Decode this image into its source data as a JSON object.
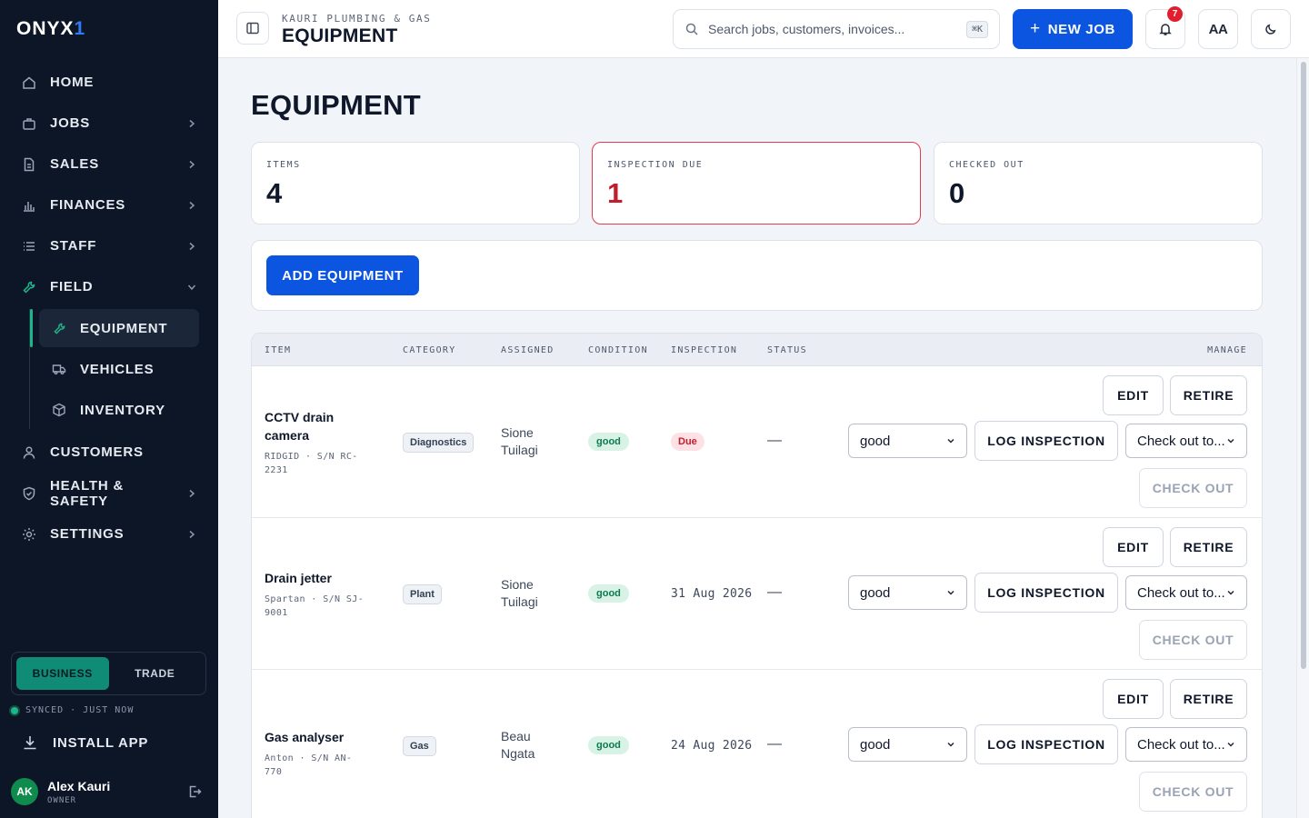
{
  "brand": {
    "logo_text": "ONYX",
    "logo_accent": "1"
  },
  "sidebar": {
    "items": [
      {
        "label": "HOME",
        "icon": "home-icon"
      },
      {
        "label": "JOBS",
        "icon": "briefcase-icon"
      },
      {
        "label": "SALES",
        "icon": "document-icon"
      },
      {
        "label": "FINANCES",
        "icon": "bar-chart-icon"
      },
      {
        "label": "STAFF",
        "icon": "list-icon"
      },
      {
        "label": "FIELD",
        "icon": "wrench-icon"
      },
      {
        "label": "CUSTOMERS",
        "icon": "person-icon"
      },
      {
        "label": "HEALTH & SAFETY",
        "icon": "shield-icon"
      },
      {
        "label": "SETTINGS",
        "icon": "sun-gear-icon"
      }
    ],
    "field_sub": [
      {
        "label": "EQUIPMENT",
        "icon": "wrench-icon",
        "active": true
      },
      {
        "label": "VEHICLES",
        "icon": "truck-icon"
      },
      {
        "label": "INVENTORY",
        "icon": "box-icon"
      }
    ],
    "mode": {
      "business": "BUSINESS",
      "trade": "TRADE"
    },
    "synced": "SYNCED · JUST NOW",
    "install": "INSTALL APP",
    "user": {
      "initials": "AK",
      "name": "Alex Kauri",
      "role": "OWNER"
    }
  },
  "topbar": {
    "org": "KAURI PLUMBING & GAS",
    "title": "EQUIPMENT",
    "search_placeholder": "Search jobs, customers, invoices...",
    "search_kbd": "⌘K",
    "new_job": "NEW JOB",
    "notifications": "7",
    "text_size": "AA"
  },
  "page": {
    "title": "EQUIPMENT",
    "stats": [
      {
        "label": "ITEMS",
        "value": "4"
      },
      {
        "label": "INSPECTION DUE",
        "value": "1"
      },
      {
        "label": "CHECKED OUT",
        "value": "0"
      }
    ],
    "add_button": "ADD EQUIPMENT",
    "columns": [
      "ITEM",
      "CATEGORY",
      "ASSIGNED",
      "CONDITION",
      "INSPECTION",
      "STATUS",
      "MANAGE"
    ],
    "rows": [
      {
        "name": "CCTV drain camera",
        "meta": "RIDGID · S/N RC-2231",
        "category": "Diagnostics",
        "assigned": "Sione Tuilagi",
        "condition": "good",
        "inspection": "Due",
        "inspection_due": true,
        "status": "—",
        "select_condition": "good",
        "checkout_placeholder": "Check out to..."
      },
      {
        "name": "Drain jetter",
        "meta": "Spartan · S/N SJ-9001",
        "category": "Plant",
        "assigned": "Sione Tuilagi",
        "condition": "good",
        "inspection": "31 Aug 2026",
        "inspection_due": false,
        "status": "—",
        "select_condition": "good",
        "checkout_placeholder": "Check out to..."
      },
      {
        "name": "Gas analyser",
        "meta": "Anton · S/N AN-770",
        "category": "Gas",
        "assigned": "Beau Ngata",
        "condition": "good",
        "inspection": "24 Aug 2026",
        "inspection_due": false,
        "status": "—",
        "select_condition": "good",
        "checkout_placeholder": "Check out to..."
      }
    ],
    "row_actions": {
      "edit": "EDIT",
      "retire": "RETIRE",
      "log": "LOG INSPECTION",
      "checkout": "CHECK OUT"
    }
  },
  "colors": {
    "accent": "#0b55e0",
    "sidebar_bg": "#0d1627",
    "teal": "#1fb58a",
    "alert": "#e23b4b"
  }
}
